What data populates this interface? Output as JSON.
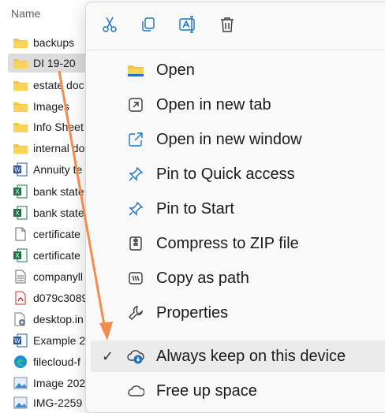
{
  "file_list": {
    "column_header": "Name",
    "rows": [
      {
        "name": "backups",
        "icon": "folder-icon"
      },
      {
        "name": "DI 19-20",
        "icon": "folder-icon",
        "selected": true
      },
      {
        "name": "estate doc",
        "icon": "folder-icon"
      },
      {
        "name": "Images",
        "icon": "folder-icon"
      },
      {
        "name": "Info Sheet",
        "icon": "folder-icon"
      },
      {
        "name": "internal do",
        "icon": "folder-icon"
      },
      {
        "name": "Annuity te",
        "icon": "word-icon"
      },
      {
        "name": "bank state",
        "icon": "excel-icon"
      },
      {
        "name": "bank state",
        "icon": "excel-icon"
      },
      {
        "name": "certificate",
        "icon": "file-icon"
      },
      {
        "name": "certificate",
        "icon": "excel-icon"
      },
      {
        "name": "companyll",
        "icon": "text-file-icon"
      },
      {
        "name": "d079c3089",
        "icon": "pdf-icon"
      },
      {
        "name": "desktop.in",
        "icon": "settings-file-icon"
      },
      {
        "name": "Example 2",
        "icon": "word-icon"
      },
      {
        "name": "filecloud-f",
        "icon": "edge-icon"
      },
      {
        "name": "Image 202",
        "icon": "image-icon"
      },
      {
        "name": "IMG-2259",
        "icon": "image-icon"
      }
    ]
  },
  "context_menu": {
    "toolbar": [
      {
        "action": "cut",
        "icon": "scissors-icon"
      },
      {
        "action": "copy",
        "icon": "copy-icon"
      },
      {
        "action": "rename",
        "icon": "rename-icon"
      },
      {
        "action": "delete",
        "icon": "trash-icon"
      }
    ],
    "items": [
      {
        "label": "Open",
        "icon": "folder-icon"
      },
      {
        "label": "Open in new tab",
        "icon": "new-tab-icon"
      },
      {
        "label": "Open in new window",
        "icon": "new-window-icon"
      },
      {
        "label": "Pin to Quick access",
        "icon": "pin-icon"
      },
      {
        "label": "Pin to Start",
        "icon": "pin-icon"
      },
      {
        "label": "Compress to ZIP file",
        "icon": "zip-icon"
      },
      {
        "label": "Copy as path",
        "icon": "copy-path-icon"
      },
      {
        "label": "Properties",
        "icon": "wrench-icon"
      },
      {
        "label": "Always keep on this device",
        "icon": "cloud-download-icon",
        "checked": true
      },
      {
        "label": "Free up space",
        "icon": "cloud-icon"
      }
    ]
  },
  "colors": {
    "folder": "#f4c63d",
    "accent": "#1a73c9",
    "arrow": "#f58b4c"
  }
}
